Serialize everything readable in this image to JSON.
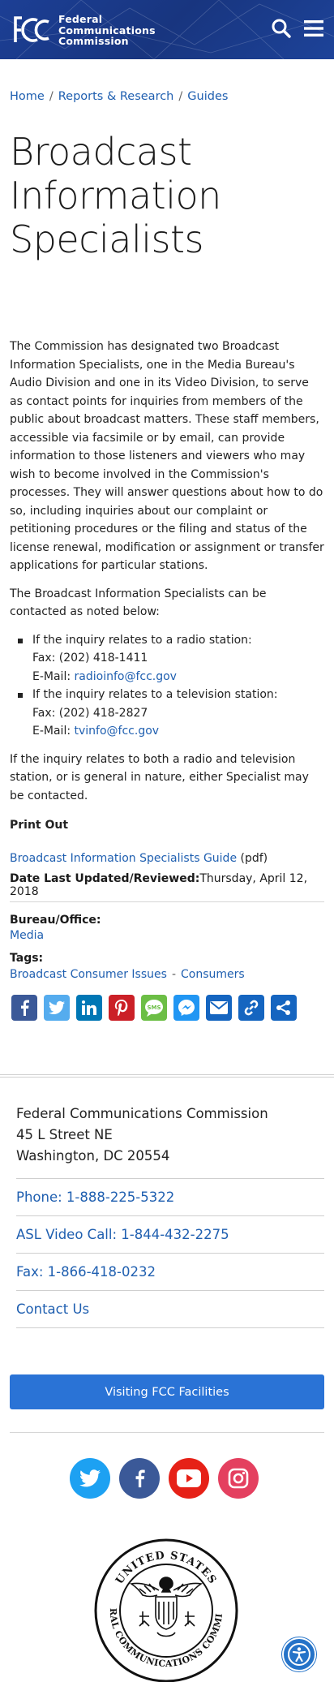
{
  "header": {
    "org_line1": "Federal",
    "org_line2": "Communications",
    "org_line3": "Commission",
    "brand_color": "#1c3f95",
    "icons": [
      "search-icon",
      "menu-icon"
    ]
  },
  "breadcrumb": {
    "items": [
      "Home",
      "Reports & Research",
      "Guides"
    ],
    "separator": "/"
  },
  "page_title": "Broadcast Information Specialists",
  "body": {
    "intro": "The Commission has designated two Broadcast Information Specialists, one in the Media Bureau's Audio Division and one in its Video Division, to serve as contact points for inquiries from members of the public about broadcast matters. These staff members, accessible via facsimile or by email, can provide information to those listeners and viewers who may wish to become involved in the Commission's processes. They will answer questions about how to do so, including inquiries about our complaint or petitioning procedures or the filing and status of the license renewal, modification or assignment or transfer applications for particular stations.",
    "contact_intro": "The Broadcast Information Specialists can be contacted as noted below:",
    "radio": {
      "heading": "If the inquiry relates to a radio station:",
      "fax": "Fax: (202) 418-1411",
      "email_label": "E-Mail: ",
      "email": "radioinfo@fcc.gov"
    },
    "tv": {
      "heading": "If the inquiry relates to a television station:",
      "fax": "Fax: (202) 418-2827",
      "email_label": "E-Mail: ",
      "email": "tvinfo@fcc.gov"
    },
    "both": "If the inquiry relates to both a radio and television station, or is general in nature, either Specialist may be contacted.",
    "print_title": "Print Out",
    "guide_link": "Broadcast Information Specialists Guide",
    "guide_suffix": " (pdf)"
  },
  "meta": {
    "updated_label": "Date Last Updated/Reviewed:",
    "updated_value": "Thursday, April 12, 2018",
    "bureau_label": "Bureau/Office:",
    "bureau_value": "Media",
    "tags_label": "Tags:",
    "tags": [
      "Broadcast Consumer Issues",
      "Consumers"
    ],
    "tag_separator": "-"
  },
  "share": [
    {
      "name": "facebook-share-icon",
      "color": "#3b5998"
    },
    {
      "name": "twitter-share-icon",
      "color": "#55acee"
    },
    {
      "name": "linkedin-share-icon",
      "color": "#0077b5"
    },
    {
      "name": "pinterest-share-icon",
      "color": "#cb2027"
    },
    {
      "name": "sms-share-icon",
      "color": "#6cbe45"
    },
    {
      "name": "messenger-share-icon",
      "color": "#2196f3"
    },
    {
      "name": "email-share-icon",
      "color": "#1565c0"
    },
    {
      "name": "copy-link-share-icon",
      "color": "#1565c0"
    },
    {
      "name": "more-share-icon",
      "color": "#1565c0"
    }
  ],
  "footer": {
    "org": "Federal Communications Commission",
    "street": "45 L Street NE",
    "city": "Washington, DC 20554",
    "phone": "Phone: 1-888-225-5322",
    "asl": "ASL Video Call: 1-844-432-2275",
    "fax": "Fax: 1-866-418-0232",
    "contact": "Contact Us",
    "visit_button": "Visiting FCC Facilities"
  },
  "social": [
    {
      "name": "twitter-icon",
      "color": "#1da1f2"
    },
    {
      "name": "facebook-icon",
      "color": "#3b5998"
    },
    {
      "name": "youtube-icon",
      "color": "#e62117"
    },
    {
      "name": "instagram-icon",
      "color": "#e4405f"
    }
  ],
  "seal": {
    "top_text": "UNITED STATES",
    "bottom_text": "FEDERAL COMMUNICATIONS COMMISSION"
  },
  "accessibility_icon": "accessibility-icon"
}
